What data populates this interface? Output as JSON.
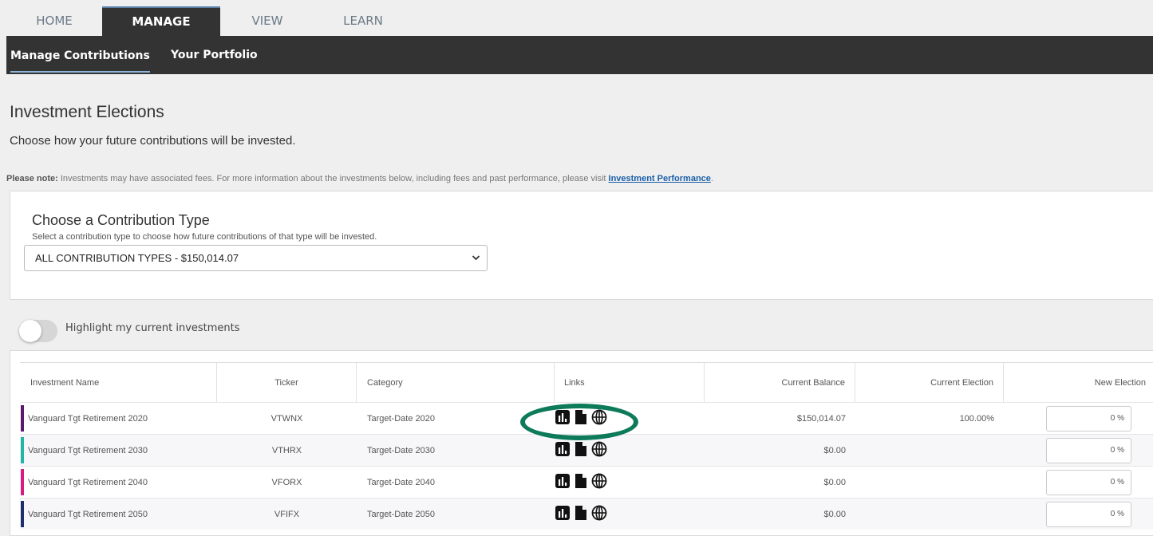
{
  "top_tabs": [
    "HOME",
    "MANAGE",
    "VIEW",
    "LEARN"
  ],
  "sub_nav": [
    "Manage Contributions",
    "Your Portfolio"
  ],
  "page": {
    "title": "Investment Elections",
    "subtitle": "Choose how your future contributions will be invested."
  },
  "note": {
    "label": "Please note:",
    "text": " Investments may have associated fees. For more information about the investments below, including fees and past performance, please visit ",
    "link": "Investment Performance",
    "end": "."
  },
  "contribution": {
    "title": "Choose a Contribution Type",
    "help": "Select a contribution type to choose how future contributions of that type will be invested.",
    "selected": "ALL CONTRIBUTION TYPES - $150,014.07"
  },
  "toggle": {
    "label": "Highlight my current investments",
    "on": false
  },
  "table": {
    "headers": [
      "Investment Name",
      "Ticker",
      "Category",
      "Links",
      "Current Balance",
      "Current Election",
      "New Election"
    ],
    "rows": [
      {
        "name": "Vanguard Tgt Retirement 2020",
        "ticker": "VTWNX",
        "category": "Target-Date 2020",
        "balance": "$150,014.07",
        "election": "100.00%",
        "new": "0 %",
        "color": "#5b1a6e"
      },
      {
        "name": "Vanguard Tgt Retirement 2030",
        "ticker": "VTHRX",
        "category": "Target-Date 2030",
        "balance": "$0.00",
        "election": "",
        "new": "0 %",
        "color": "#22b5a4"
      },
      {
        "name": "Vanguard Tgt Retirement 2040",
        "ticker": "VFORX",
        "category": "Target-Date 2040",
        "balance": "$0.00",
        "election": "",
        "new": "0 %",
        "color": "#d81b7c"
      },
      {
        "name": "Vanguard Tgt Retirement 2050",
        "ticker": "VFIFX",
        "category": "Target-Date 2050",
        "balance": "$0.00",
        "election": "",
        "new": "0 %",
        "color": "#1c2f6e"
      }
    ]
  },
  "icons": {
    "links": [
      "bar-chart-icon",
      "document-icon",
      "globe-icon"
    ],
    "select_chevron": "chevron-down-icon"
  },
  "colors": {
    "nav_dark": "#333333",
    "annotation_ring": "#0d7a5a",
    "link": "#1a5fa8"
  }
}
